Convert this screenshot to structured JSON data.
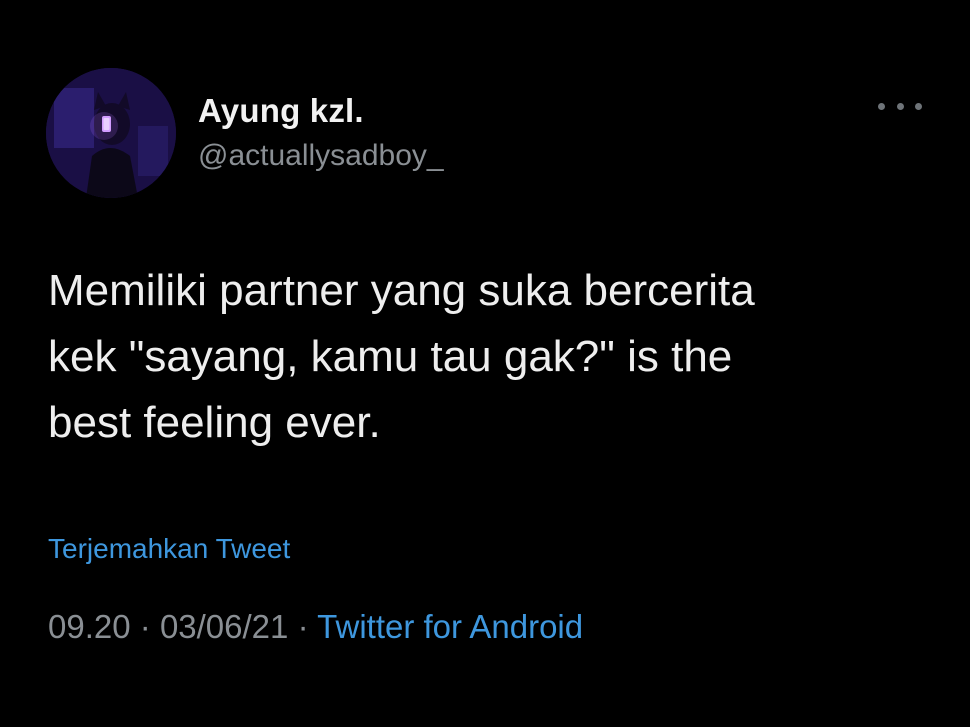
{
  "tweet": {
    "author": {
      "display_name": "Ayung kzl.",
      "handle": "@actuallysadboy_",
      "avatar_icon": "user-avatar"
    },
    "more_icon": "more-horizontal-icon",
    "text": "Memiliki partner yang suka bercerita\nkek \"sayang, kamu tau gak?\" is the\nbest feeling ever.",
    "translate_label": "Terjemahkan Tweet",
    "meta": {
      "time": "09.20",
      "separator": "·",
      "date": "03/06/21",
      "source": "Twitter for Android"
    }
  },
  "colors": {
    "background": "#000000",
    "text_primary": "#eeeeee",
    "text_secondary": "#8a8f94",
    "link": "#3e97de"
  }
}
